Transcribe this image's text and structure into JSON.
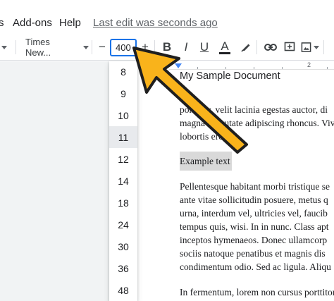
{
  "menubar": {
    "items": [
      "s",
      "Add-ons",
      "Help"
    ],
    "last_edit": "Last edit was seconds ago"
  },
  "toolbar": {
    "font_name": "Times New...",
    "font_size_value": "400",
    "decrease_label": "−",
    "increase_label": "+",
    "bold_label": "B",
    "italic_label": "I",
    "underline_label": "U",
    "text_color_label": "A",
    "text_color_bar": "#202124",
    "accent": "#1a73e8"
  },
  "ruler": {
    "mark": "2"
  },
  "font_sizes": {
    "options": [
      "8",
      "9",
      "10",
      "11",
      "12",
      "14",
      "18",
      "24",
      "30",
      "36",
      "48"
    ],
    "selected": "11"
  },
  "document": {
    "title": "My Sample Document",
    "para1": [
      "porttitor, velit lacinia egestas auctor, di",
      "magna vulputate adipiscing rhoncus. Viv",
      "lobortis eros."
    ],
    "example": "Example text",
    "para2": [
      "Pellentesque habitant morbi tristique se",
      "ante vitae sollicitudin posuere, metus q",
      "urna, interdum vel, ultricies vel, faucib",
      "tempus quis, wisi. In in nunc. Class apt",
      "inceptos hymenaeos. Donec ullamcorp",
      "sociis natoque penatibus et magnis dis",
      "condimentum odio. Sed ac ligula. Aliqu"
    ],
    "para3": "In fermentum, lorem non cursus porttitor"
  },
  "annotation": {
    "arrow_color": "#f9b31b"
  }
}
